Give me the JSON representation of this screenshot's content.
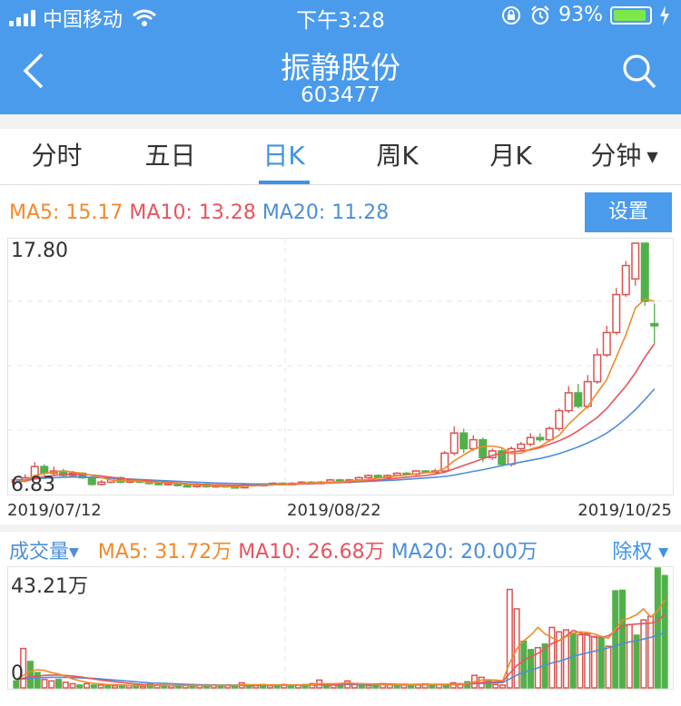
{
  "status": {
    "carrier": "中国移动",
    "time": "下午3:28",
    "battery": "93%",
    "battery_level": 0.93
  },
  "header": {
    "title": "振静股份",
    "code": "603477"
  },
  "tabs": [
    {
      "label": "分时",
      "active": false
    },
    {
      "label": "五日",
      "active": false
    },
    {
      "label": "日K",
      "active": true
    },
    {
      "label": "周K",
      "active": false
    },
    {
      "label": "月K",
      "active": false
    },
    {
      "label": "分钟",
      "active": false
    }
  ],
  "price_ma": {
    "ma5": "MA5: 15.17",
    "ma10": "MA10: 13.28",
    "ma20": "MA20: 11.28"
  },
  "settings_button": "设置",
  "chart_data": [
    {
      "type": "candlestick",
      "ylim": [
        6.83,
        17.8
      ],
      "y_max_label": "17.80",
      "y_min_label": "6.83",
      "x_tick_labels": [
        "2019/07/12",
        "2019/08/22",
        "2019/10/25"
      ],
      "colors": {
        "up": "#d9534f",
        "down": "#52b04a",
        "ma5": "#f08a2c",
        "ma10": "#e7545e",
        "ma20": "#4c8fd8"
      },
      "candles": [
        [
          7.1,
          7.2,
          7.3,
          7.0
        ],
        [
          7.2,
          7.3,
          7.45,
          7.1
        ],
        [
          7.3,
          7.8,
          8.0,
          7.25
        ],
        [
          7.8,
          7.5,
          7.9,
          7.4
        ],
        [
          7.5,
          7.6,
          7.8,
          7.4
        ],
        [
          7.6,
          7.4,
          7.7,
          7.35
        ],
        [
          7.4,
          7.5,
          7.6,
          7.35
        ],
        [
          7.5,
          7.3,
          7.55,
          7.25
        ],
        [
          7.3,
          7.0,
          7.35,
          6.95
        ],
        [
          7.0,
          7.1,
          7.2,
          6.95
        ],
        [
          7.1,
          7.3,
          7.35,
          7.05
        ],
        [
          7.3,
          7.1,
          7.35,
          7.05
        ],
        [
          7.1,
          7.2,
          7.25,
          7.05
        ],
        [
          7.2,
          7.1,
          7.25,
          7.05
        ],
        [
          7.1,
          7.05,
          7.15,
          7.0
        ],
        [
          7.05,
          7.0,
          7.1,
          6.95
        ],
        [
          7.0,
          7.05,
          7.1,
          6.95
        ],
        [
          7.05,
          6.95,
          7.1,
          6.9
        ],
        [
          6.95,
          6.9,
          7.0,
          6.85
        ],
        [
          6.9,
          7.0,
          7.05,
          6.85
        ],
        [
          7.0,
          6.9,
          7.05,
          6.85
        ],
        [
          6.9,
          6.95,
          7.0,
          6.85
        ],
        [
          6.95,
          6.9,
          7.0,
          6.85
        ],
        [
          6.9,
          6.85,
          6.95,
          6.83
        ],
        [
          6.85,
          7.0,
          7.05,
          6.83
        ],
        [
          7.0,
          6.95,
          7.05,
          6.9
        ],
        [
          6.95,
          7.0,
          7.05,
          6.9
        ],
        [
          7.0,
          7.05,
          7.1,
          6.95
        ],
        [
          7.05,
          7.0,
          7.1,
          6.95
        ],
        [
          7.0,
          7.05,
          7.1,
          6.95
        ],
        [
          7.05,
          7.1,
          7.15,
          7.0
        ],
        [
          7.1,
          7.05,
          7.15,
          7.0
        ],
        [
          7.05,
          7.1,
          7.15,
          7.0
        ],
        [
          7.1,
          7.2,
          7.25,
          7.05
        ],
        [
          7.2,
          7.1,
          7.25,
          7.05
        ],
        [
          7.1,
          7.2,
          7.25,
          7.05
        ],
        [
          7.2,
          7.3,
          7.35,
          7.15
        ],
        [
          7.3,
          7.4,
          7.45,
          7.25
        ],
        [
          7.4,
          7.3,
          7.45,
          7.25
        ],
        [
          7.3,
          7.4,
          7.45,
          7.25
        ],
        [
          7.4,
          7.5,
          7.55,
          7.35
        ],
        [
          7.5,
          7.45,
          7.55,
          7.4
        ],
        [
          7.45,
          7.6,
          7.65,
          7.4
        ],
        [
          7.6,
          7.55,
          7.65,
          7.5
        ],
        [
          7.55,
          7.6,
          7.7,
          7.5
        ],
        [
          7.6,
          8.4,
          8.5,
          7.6
        ],
        [
          8.4,
          9.3,
          9.6,
          8.3
        ],
        [
          9.3,
          8.6,
          9.5,
          8.4
        ],
        [
          8.6,
          9.0,
          9.2,
          8.5
        ],
        [
          9.0,
          8.2,
          9.1,
          8.0
        ],
        [
          8.2,
          8.5,
          8.6,
          8.1
        ],
        [
          8.5,
          7.9,
          8.6,
          7.8
        ],
        [
          7.9,
          8.6,
          8.7,
          7.8
        ],
        [
          8.6,
          8.8,
          8.9,
          8.5
        ],
        [
          8.8,
          9.1,
          9.3,
          8.7
        ],
        [
          9.1,
          9.0,
          9.3,
          8.9
        ],
        [
          9.0,
          9.5,
          9.6,
          8.9
        ],
        [
          9.5,
          10.3,
          10.4,
          9.4
        ],
        [
          10.3,
          11.1,
          11.4,
          10.2
        ],
        [
          11.1,
          10.5,
          11.5,
          10.4
        ],
        [
          10.5,
          11.6,
          11.9,
          10.4
        ],
        [
          11.6,
          12.8,
          13.1,
          11.5
        ],
        [
          12.8,
          13.8,
          14.1,
          12.7
        ],
        [
          13.8,
          15.5,
          15.8,
          13.7
        ],
        [
          15.5,
          16.8,
          17.0,
          15.4
        ],
        [
          16.2,
          17.8,
          17.8,
          15.9
        ],
        [
          17.8,
          15.2,
          17.8,
          15.0
        ],
        [
          14.2,
          14.1,
          15.1,
          13.3
        ]
      ],
      "ma5": [
        7.1,
        7.2,
        7.4,
        7.5,
        7.55,
        7.6,
        7.55,
        7.5,
        7.4,
        7.3,
        7.2,
        7.15,
        7.15,
        7.15,
        7.1,
        7.1,
        7.05,
        7.05,
        7.0,
        6.97,
        6.95,
        6.93,
        6.92,
        6.9,
        6.92,
        6.94,
        6.96,
        6.98,
        7.0,
        7.02,
        7.05,
        7.07,
        7.08,
        7.1,
        7.12,
        7.15,
        7.18,
        7.22,
        7.28,
        7.33,
        7.38,
        7.42,
        7.47,
        7.52,
        7.56,
        7.72,
        8.06,
        8.32,
        8.58,
        8.7,
        8.72,
        8.64,
        8.38,
        8.4,
        8.58,
        8.7,
        8.96,
        9.2,
        9.7,
        10.1,
        10.5,
        11.1,
        11.7,
        12.7,
        13.7,
        14.9,
        15.3,
        15.2
      ],
      "ma10": [
        7.1,
        7.15,
        7.25,
        7.35,
        7.4,
        7.45,
        7.45,
        7.45,
        7.42,
        7.38,
        7.32,
        7.27,
        7.23,
        7.2,
        7.16,
        7.12,
        7.09,
        7.06,
        7.03,
        7.01,
        6.99,
        6.98,
        6.97,
        6.96,
        6.96,
        6.96,
        6.97,
        6.98,
        6.99,
        7.0,
        7.02,
        7.03,
        7.05,
        7.07,
        7.09,
        7.11,
        7.14,
        7.17,
        7.2,
        7.24,
        7.28,
        7.32,
        7.36,
        7.4,
        7.46,
        7.55,
        7.7,
        7.85,
        8.0,
        8.15,
        8.3,
        8.4,
        8.45,
        8.5,
        8.55,
        8.65,
        8.8,
        8.95,
        9.15,
        9.4,
        9.7,
        10.0,
        10.4,
        10.9,
        11.4,
        12.0,
        12.7,
        13.3
      ],
      "ma20": [
        7.2,
        7.22,
        7.25,
        7.28,
        7.3,
        7.32,
        7.33,
        7.33,
        7.32,
        7.3,
        7.28,
        7.26,
        7.24,
        7.22,
        7.2,
        7.18,
        7.16,
        7.14,
        7.12,
        7.1,
        7.08,
        7.06,
        7.05,
        7.04,
        7.03,
        7.02,
        7.02,
        7.02,
        7.02,
        7.03,
        7.04,
        7.05,
        7.06,
        7.07,
        7.08,
        7.1,
        7.12,
        7.14,
        7.16,
        7.18,
        7.2,
        7.23,
        7.26,
        7.29,
        7.32,
        7.36,
        7.42,
        7.5,
        7.58,
        7.66,
        7.75,
        7.84,
        7.92,
        8.0,
        8.08,
        8.16,
        8.26,
        8.38,
        8.52,
        8.68,
        8.86,
        9.06,
        9.3,
        9.6,
        9.95,
        10.35,
        10.8,
        11.28
      ]
    },
    {
      "type": "bar",
      "ylim": [
        0,
        43.21
      ],
      "y_max_label": "43.21万",
      "y_min_label": "0",
      "unit": "万",
      "volumes": [
        2.5,
        14.2,
        9.5,
        5.5,
        3.0,
        2.5,
        3.0,
        2.0,
        1.5,
        1.0,
        1.5,
        1.0,
        1.0,
        0.8,
        0.8,
        1.0,
        0.8,
        0.8,
        0.6,
        1.5,
        1.0,
        0.8,
        0.8,
        0.6,
        1.0,
        0.8,
        1.0,
        0.8,
        1.0,
        0.8,
        1.0,
        0.8,
        1.8,
        1.0,
        0.8,
        1.2,
        0.8,
        1.0,
        1.2,
        0.8,
        1.0,
        1.2,
        1.5,
        2.8,
        1.0,
        1.0,
        1.5,
        2.5,
        1.5,
        1.0,
        0.8,
        1.0,
        1.5,
        1.2,
        1.0,
        1.0,
        1.2,
        1.0,
        1.4,
        1.2,
        1.2,
        1.0,
        1.8,
        1.5,
        2.2,
        4.5,
        3.8,
        2.5,
        1.2,
        1.0,
        35.5,
        28.5,
        16.8,
        13.8,
        14.5,
        15.8,
        21.8,
        20.2,
        20.9,
        19.8,
        19.2,
        19.5,
        18.5,
        18.2,
        15.0,
        35.0,
        35.2,
        22.8,
        19.0,
        24.5,
        25.8,
        43.21,
        40.5
      ],
      "up": [
        false,
        true,
        false,
        false,
        true,
        true,
        false,
        true,
        true,
        false,
        true,
        false,
        true,
        false,
        true,
        false,
        true,
        false,
        true,
        false,
        true,
        false,
        true,
        false,
        true,
        false,
        true,
        false,
        true,
        false,
        true,
        false,
        true,
        false,
        true,
        false,
        true,
        false,
        true,
        false,
        true,
        false,
        true,
        true,
        false,
        true,
        false,
        true,
        true,
        false,
        true,
        false,
        true,
        true,
        false,
        true,
        false,
        true,
        true,
        false,
        true,
        false,
        true,
        true,
        false,
        true,
        true,
        false,
        true,
        true,
        true,
        true,
        false,
        false,
        true,
        false,
        true,
        true,
        true,
        false,
        true,
        true,
        true,
        false,
        true,
        false,
        false,
        true,
        false,
        true,
        true,
        false,
        false
      ],
      "ma5": [
        3.0,
        4.5,
        6.0,
        6.5,
        6.3,
        5.5,
        5.0,
        4.2,
        3.2,
        2.6,
        2.0,
        1.6,
        1.4,
        1.2,
        1.1,
        1.0,
        0.9,
        0.9,
        0.8,
        0.9,
        0.9,
        0.9,
        0.9,
        0.9,
        0.9,
        0.8,
        0.9,
        0.9,
        0.9,
        0.9,
        0.9,
        0.9,
        1.1,
        1.1,
        1.1,
        1.1,
        1.0,
        1.0,
        1.0,
        1.0,
        1.0,
        1.0,
        1.1,
        1.5,
        1.5,
        1.5,
        1.6,
        1.8,
        1.6,
        1.5,
        1.4,
        1.3,
        1.2,
        1.1,
        1.1,
        1.1,
        1.1,
        1.1,
        1.2,
        1.2,
        1.2,
        1.2,
        1.3,
        1.3,
        1.5,
        2.2,
        2.8,
        2.9,
        2.8,
        2.6,
        8.9,
        14.0,
        17.0,
        19.0,
        21.8,
        19.5,
        18.1,
        17.0,
        18.5,
        19.7,
        20.2,
        20.0,
        19.4,
        18.6,
        17.9,
        21.1,
        24.4,
        25.2,
        26.4,
        28.5,
        25.5,
        27.8,
        31.72
      ],
      "ma10": [
        3.0,
        3.5,
        4.0,
        4.3,
        4.5,
        4.6,
        4.6,
        4.5,
        4.3,
        4.0,
        3.6,
        3.2,
        2.8,
        2.5,
        2.2,
        1.9,
        1.6,
        1.4,
        1.2,
        1.1,
        1.0,
        1.0,
        0.9,
        0.9,
        0.9,
        0.9,
        0.9,
        0.9,
        0.9,
        0.9,
        0.9,
        0.9,
        0.9,
        0.9,
        1.0,
        1.0,
        1.0,
        1.0,
        1.0,
        1.0,
        1.0,
        1.0,
        1.1,
        1.2,
        1.2,
        1.2,
        1.3,
        1.4,
        1.4,
        1.4,
        1.4,
        1.4,
        1.4,
        1.4,
        1.3,
        1.3,
        1.2,
        1.2,
        1.2,
        1.2,
        1.2,
        1.2,
        1.2,
        1.2,
        1.3,
        1.6,
        1.9,
        2.1,
        2.2,
        2.3,
        5.2,
        8.0,
        10.0,
        11.3,
        12.4,
        14.2,
        16.0,
        17.0,
        18.8,
        20.8,
        19.8,
        19.0,
        18.3,
        18.2,
        18.8,
        20.6,
        22.3,
        22.8,
        23.0,
        23.2,
        23.3,
        24.1,
        26.68
      ],
      "ma20": [
        3.0,
        3.2,
        3.4,
        3.6,
        3.7,
        3.8,
        3.8,
        3.8,
        3.7,
        3.6,
        3.5,
        3.4,
        3.2,
        3.0,
        2.8,
        2.6,
        2.4,
        2.2,
        2.0,
        1.8,
        1.7,
        1.6,
        1.5,
        1.4,
        1.3,
        1.2,
        1.1,
        1.1,
        1.0,
        1.0,
        1.0,
        1.0,
        1.0,
        1.0,
        1.0,
        1.0,
        1.0,
        1.0,
        1.0,
        1.0,
        1.0,
        1.0,
        1.0,
        1.1,
        1.1,
        1.1,
        1.1,
        1.2,
        1.2,
        1.2,
        1.2,
        1.2,
        1.2,
        1.2,
        1.2,
        1.2,
        1.2,
        1.3,
        1.3,
        1.3,
        1.3,
        1.3,
        1.3,
        1.3,
        1.4,
        1.5,
        1.6,
        1.7,
        1.8,
        1.9,
        3.2,
        4.6,
        5.6,
        6.4,
        7.2,
        8.2,
        9.0,
        9.6,
        10.4,
        11.4,
        12.0,
        12.6,
        13.2,
        13.8,
        14.4,
        15.2,
        16.0,
        16.6,
        17.0,
        17.6,
        18.2,
        19.0,
        20.0
      ]
    }
  ],
  "volume": {
    "label": "成交量",
    "ma5": "MA5: 31.72万",
    "ma10": "MA10: 26.68万",
    "ma20": "MA20: 20.00万",
    "right_label": "除权"
  }
}
